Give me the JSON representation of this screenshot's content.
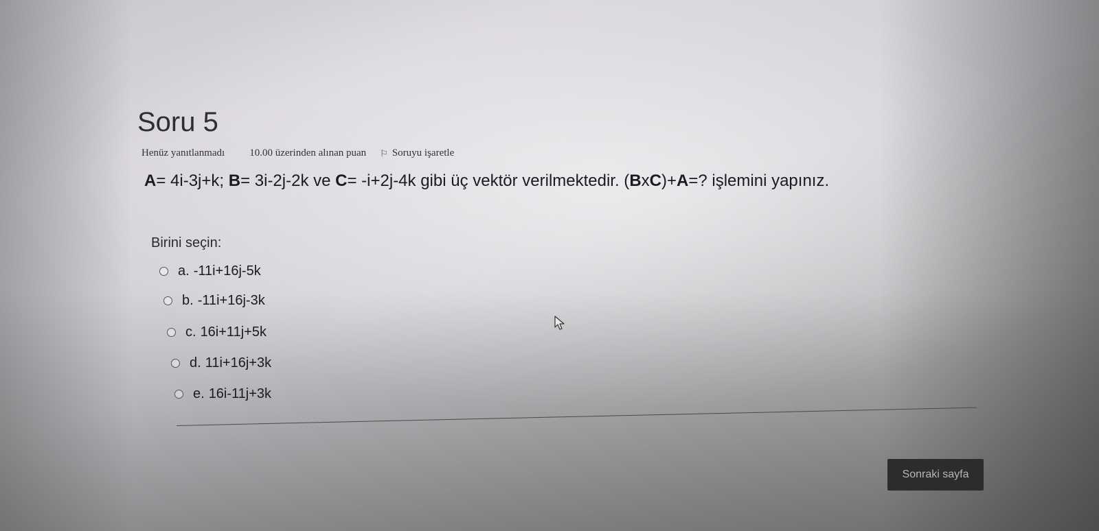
{
  "question": {
    "title": "Soru 5",
    "status": "Henüz yanıtlanmadı",
    "grade": "10.00 üzerinden alınan puan",
    "flag_label": "Soruyu işaretle",
    "text_parts": [
      "A",
      "= 4i-3j+k; ",
      "B",
      "= 3i-2j-2k",
      " ve ",
      "C",
      "= -i+2j-4k",
      " gibi üç vektör verilmektedir. (",
      "B",
      "x",
      "C",
      ")+",
      "A",
      "=? işlemini yapınız."
    ]
  },
  "prompt": "Birini seçin:",
  "options": [
    {
      "letter": "a.",
      "value": "-11i+16j-5k"
    },
    {
      "letter": "b.",
      "value": "-11i+16j-3k"
    },
    {
      "letter": "c.",
      "value": "16i+11j+5k"
    },
    {
      "letter": "d.",
      "value": "11i+16j+3k"
    },
    {
      "letter": "e.",
      "value": "16i-11j+3k"
    }
  ],
  "next_button": "Sonraki sayfa",
  "icons": {
    "flag": "flag-icon",
    "cursor": "mouse-pointer-icon"
  }
}
